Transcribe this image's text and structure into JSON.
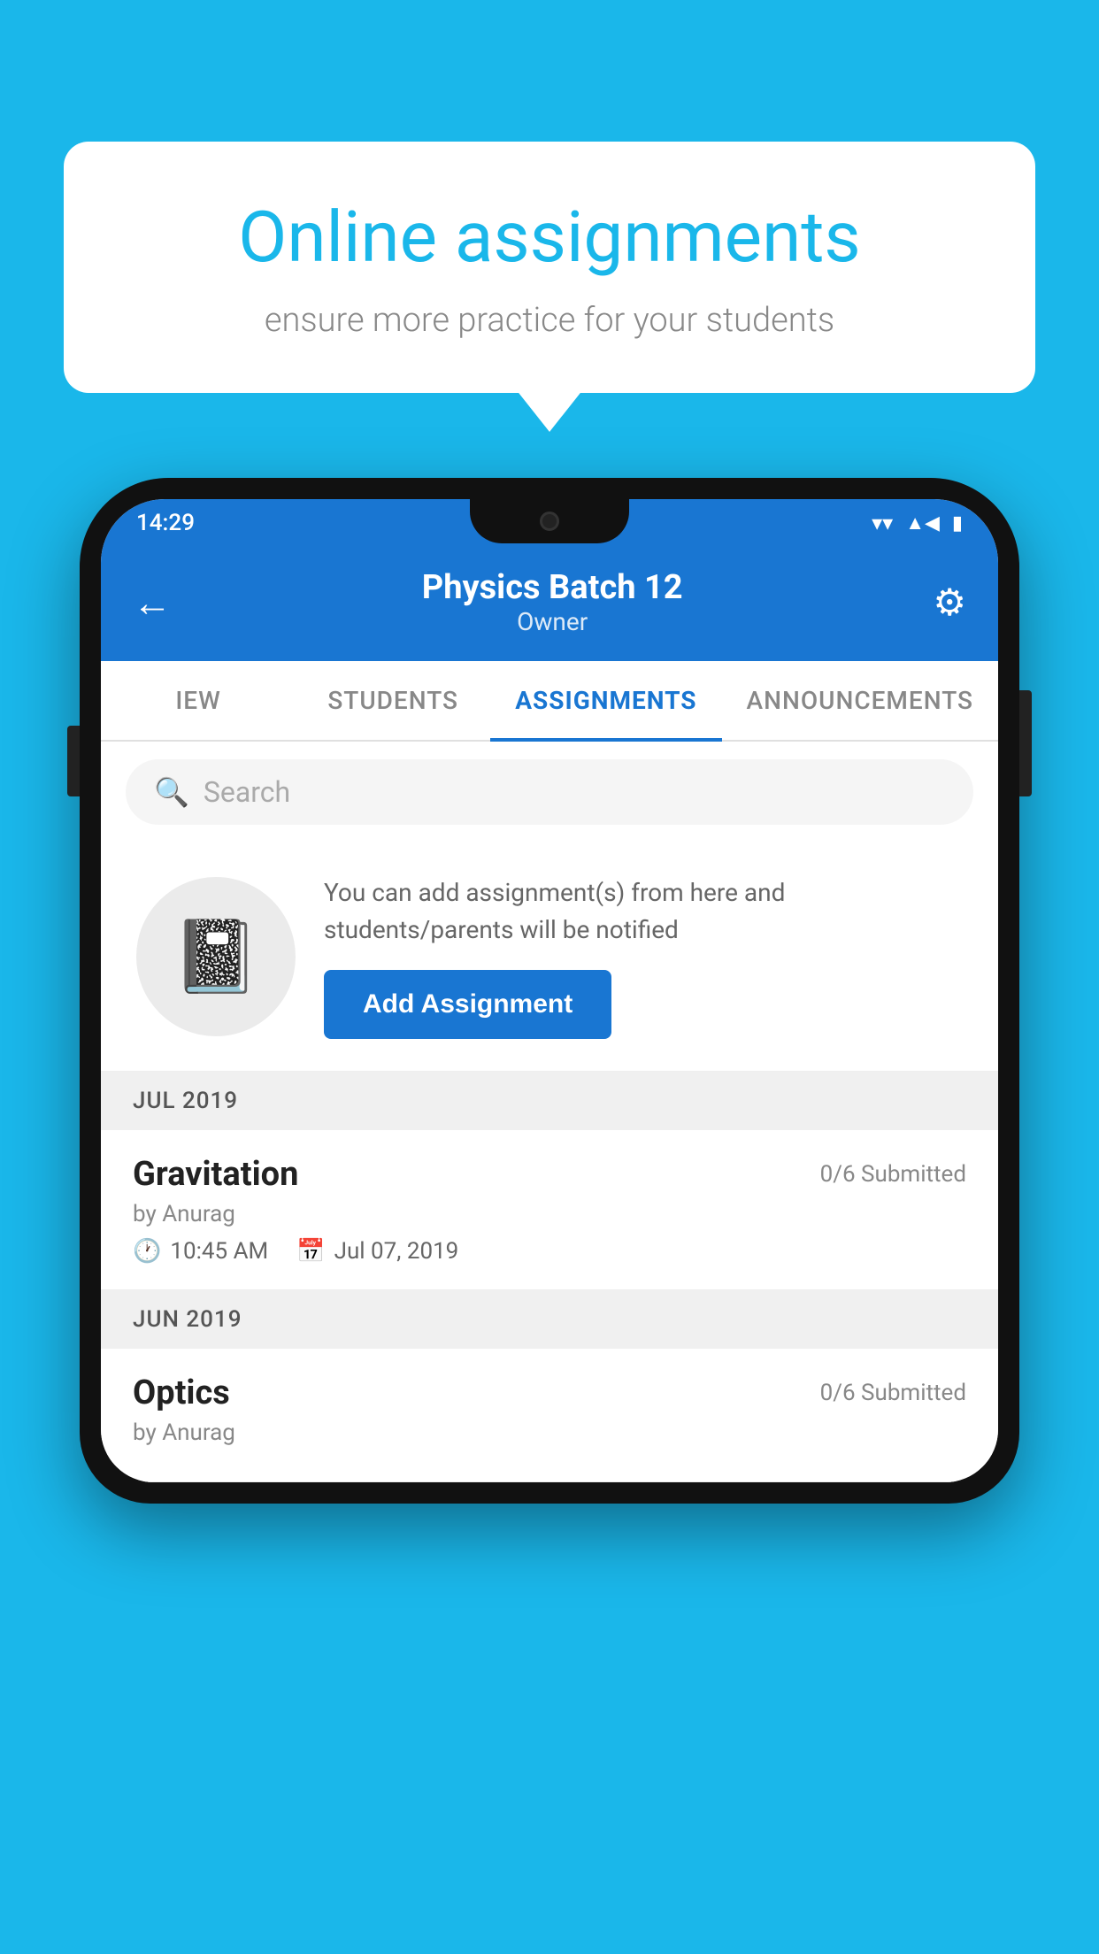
{
  "background": {
    "color": "#1ab7ea"
  },
  "speech_bubble": {
    "title": "Online assignments",
    "subtitle": "ensure more practice for your students"
  },
  "status_bar": {
    "time": "14:29",
    "wifi_icon": "wifi-icon",
    "signal_icon": "signal-icon",
    "battery_icon": "battery-icon"
  },
  "app_header": {
    "back_label": "←",
    "title": "Physics Batch 12",
    "subtitle": "Owner",
    "settings_icon": "gear-icon"
  },
  "tabs": [
    {
      "label": "IEW",
      "active": false
    },
    {
      "label": "STUDENTS",
      "active": false
    },
    {
      "label": "ASSIGNMENTS",
      "active": true
    },
    {
      "label": "ANNOUNCEMENTS",
      "active": false
    }
  ],
  "search": {
    "placeholder": "Search",
    "icon": "search-icon"
  },
  "promo": {
    "description": "You can add assignment(s) from here and students/parents will be notified",
    "add_button_label": "Add Assignment",
    "icon": "📓"
  },
  "sections": [
    {
      "header": "JUL 2019",
      "assignments": [
        {
          "name": "Gravitation",
          "submitted": "0/6 Submitted",
          "author": "by Anurag",
          "time": "10:45 AM",
          "date": "Jul 07, 2019"
        }
      ]
    },
    {
      "header": "JUN 2019",
      "assignments": [
        {
          "name": "Optics",
          "submitted": "0/6 Submitted",
          "author": "by Anurag",
          "time": "",
          "date": ""
        }
      ]
    }
  ]
}
